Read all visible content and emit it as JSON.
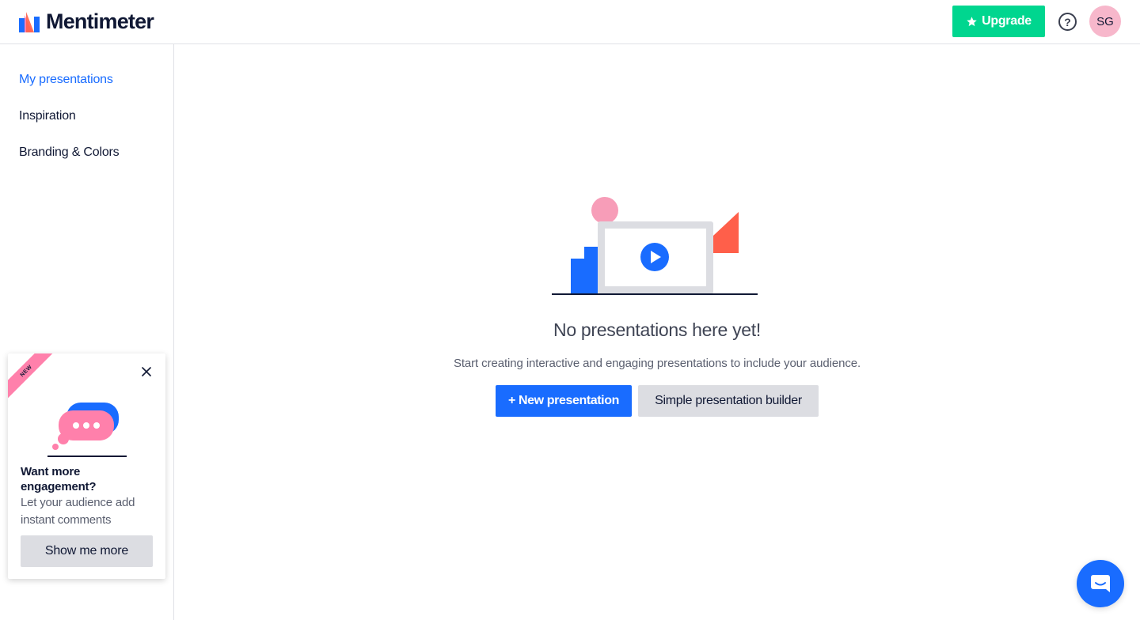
{
  "header": {
    "brand": "Mentimeter",
    "upgrade_label": "Upgrade",
    "help_glyph": "?",
    "avatar_initials": "SG"
  },
  "sidebar": {
    "items": [
      {
        "label": "My presentations",
        "active": true
      },
      {
        "label": "Inspiration",
        "active": false
      },
      {
        "label": "Branding & Colors",
        "active": false
      }
    ]
  },
  "promo": {
    "ribbon": "NEW",
    "title": "Want more engagement?",
    "description": "Let your audience add instant comments",
    "button_label": "Show me more"
  },
  "main": {
    "empty_title": "No presentations here yet!",
    "empty_subtitle": "Start creating interactive and engaging presentations to include your audience.",
    "new_button_label": "+ New presentation",
    "simple_button_label": "Simple presentation builder"
  },
  "colors": {
    "accent": "#196cff",
    "upgrade": "#00d68f",
    "pink": "#ff80ab",
    "coral": "#ff5f4a"
  },
  "icons": {
    "upgrade": "star-icon",
    "help": "question-circle-icon",
    "close": "close-icon",
    "chat": "chat-bubble-icon",
    "empty_state": "presentation-play-illustration"
  }
}
